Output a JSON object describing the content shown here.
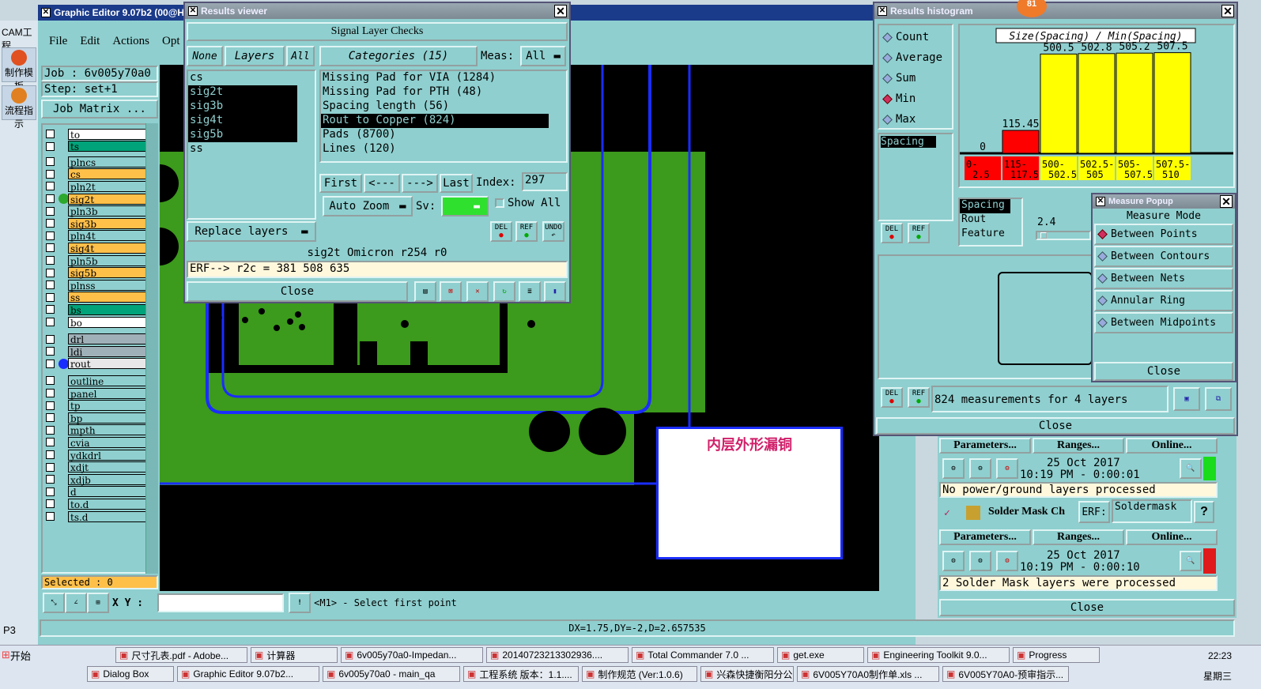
{
  "main_window": {
    "title": "Graphic Editor 9.07b2 (00@HY",
    "menu": [
      "File",
      "Edit",
      "Actions",
      "Opt"
    ],
    "job_label": "Job : 6v005y70a0",
    "step_label": "Step: set+1",
    "job_matrix_label": "Job Matrix ...",
    "selected_label": "Selected : 0",
    "xy_label": "X Y :",
    "status_prompt": "<M1> - Select first point",
    "measure_readout": "DX=1.75,DY=-2,D=2.657535",
    "annotation_text": "内层外形漏铜"
  },
  "left_cam": {
    "title": "CAM工程",
    "item1": "制作模板",
    "item2": "流程指示",
    "p3": "P3"
  },
  "layers": [
    {
      "name": "to",
      "color": "#ffffff"
    },
    {
      "name": "ts",
      "color": "#00a37a"
    },
    {
      "name": "plncs",
      "color": "#8fcfcf"
    },
    {
      "name": "cs",
      "color": "#ffc04a"
    },
    {
      "name": "pln2t",
      "color": "#8fcfcf"
    },
    {
      "name": "sig2t",
      "color": "#ffc04a"
    },
    {
      "name": "pln3b",
      "color": "#8fcfcf"
    },
    {
      "name": "sig3b",
      "color": "#ffc04a"
    },
    {
      "name": "pln4t",
      "color": "#8fcfcf"
    },
    {
      "name": "sig4t",
      "color": "#ffc04a"
    },
    {
      "name": "pln5b",
      "color": "#8fcfcf"
    },
    {
      "name": "sig5b",
      "color": "#ffc04a"
    },
    {
      "name": "plnss",
      "color": "#8fcfcf"
    },
    {
      "name": "ss",
      "color": "#ffc04a"
    },
    {
      "name": "bs",
      "color": "#00a37a"
    },
    {
      "name": "bo",
      "color": "#ffffff"
    },
    {
      "name": "drl",
      "color": "#9fb0b8"
    },
    {
      "name": "ldi",
      "color": "#9fb0b8"
    },
    {
      "name": "rout",
      "color": "#e8e8e8"
    },
    {
      "name": "outline",
      "color": "#8fcfcf"
    },
    {
      "name": "panel",
      "color": "#8fcfcf"
    },
    {
      "name": "tp",
      "color": "#8fcfcf"
    },
    {
      "name": "bp",
      "color": "#8fcfcf"
    },
    {
      "name": "mpth",
      "color": "#8fcfcf"
    },
    {
      "name": "cvia",
      "color": "#8fcfcf"
    },
    {
      "name": "ydkdrl",
      "color": "#8fcfcf"
    },
    {
      "name": "xdjt",
      "color": "#8fcfcf"
    },
    {
      "name": "xdjb",
      "color": "#8fcfcf"
    },
    {
      "name": "d",
      "color": "#8fcfcf"
    },
    {
      "name": "to.d",
      "color": "#8fcfcf"
    },
    {
      "name": "ts.d",
      "color": "#8fcfcf"
    }
  ],
  "results_viewer": {
    "title": "Results viewer",
    "header": "Signal Layer Checks",
    "none": "None",
    "layers_btn": "Layers",
    "all": "All",
    "categories_btn": "Categories (15)",
    "meas_label": "Meas:",
    "meas_value": "All",
    "layer_list": [
      "cs",
      "sig2t",
      "sig3b",
      "sig4t",
      "sig5b",
      "ss"
    ],
    "categories": [
      "Missing Pad for VIA (1284)",
      "Missing Pad for PTH (48)",
      "Spacing length (56)",
      "Rout to Copper (824)",
      "Pads (8700)",
      "Lines (120)"
    ],
    "first": "First",
    "prev": "<---",
    "next": "--->",
    "last": "Last",
    "index_label": "Index:",
    "index_value": "297",
    "autozoom": "Auto Zoom",
    "sv_label": "Sv:",
    "showall": "Show All",
    "replace": "Replace layers",
    "del": "DEL",
    "ref": "REF",
    "undo": "UNDO",
    "status_line": "sig2t Omicron  r254  r0",
    "erf_line": "ERF--> r2c = 381 508 635",
    "close": "Close"
  },
  "histogram": {
    "title": "Results histogram",
    "badge": "81",
    "options": [
      "Count",
      "Average",
      "Sum",
      "Min",
      "Max"
    ],
    "selected_option": "Min",
    "chart_title": "Size(Spacing) / Min(Spacing)",
    "list_item": "Spacing",
    "lower_list": [
      "Spacing",
      "Rout",
      "Feature"
    ],
    "slider_value": "2.4",
    "summary": "824 measurements for 4 layers",
    "close": "Close",
    "del": "DEL",
    "ref": "REF"
  },
  "chart_data": {
    "type": "bar",
    "title": "Size(Spacing) / Min(Spacing)",
    "categories": [
      "0-2.5",
      "115-117.5",
      "500-502.5",
      "502.5-505",
      "505-507.5",
      "507.5-510"
    ],
    "values": [
      0,
      115.45,
      500.5,
      502.8,
      505.2,
      507.5
    ],
    "value_labels": [
      "0",
      "115.45",
      "500.5",
      "502.8",
      "505.2",
      "507.5"
    ],
    "bar_colors": [
      "#ff0000",
      "#ff0000",
      "#ffff00",
      "#ffff00",
      "#ffff00",
      "#ffff00"
    ]
  },
  "measure_popup": {
    "title": "Measure Popup",
    "heading": "Measure Mode",
    "options": [
      "Between Points",
      "Between Contours",
      "Between Nets",
      "Annular Ring",
      "Between Midpoints"
    ],
    "selected": "Between Points",
    "close": "Close"
  },
  "checklist": {
    "parameters": "Parameters...",
    "ranges": "Ranges...",
    "online": "Online...",
    "date1": "25 Oct 2017",
    "time1": "10:19 PM - 0:00:01",
    "msg1": "No power/ground layers processed",
    "solder_name": "Solder Mask Ch",
    "erf_label": "ERF:",
    "erf_value": "Soldermask",
    "help": "?",
    "date2": "25 Oct 2017",
    "time2": "10:19 PM - 0:00:10",
    "msg2": "2 Solder Mask layers were processed",
    "close": "Close"
  },
  "taskbar": {
    "start": "开始",
    "row1": [
      "尺寸孔表.pdf - Adobe...",
      "计算器",
      "6v005y70a0-Impedan...",
      "20140723213302936....",
      "Total Commander 7.0 ...",
      "get.exe",
      "Engineering Toolkit 9.0...",
      "Progress"
    ],
    "row2": [
      "Dialog Box",
      "Graphic Editor 9.07b2...",
      "6v005y70a0 - main_qa",
      "工程系统  版本：1.1....",
      "制作规范 (Ver:1.0.6)",
      "兴森快捷衡阳分公司...",
      "6V005Y70A0制作单.xls ...",
      "6V005Y70A0-预审指示..."
    ],
    "clock": "22:23",
    "day": "星期三"
  }
}
